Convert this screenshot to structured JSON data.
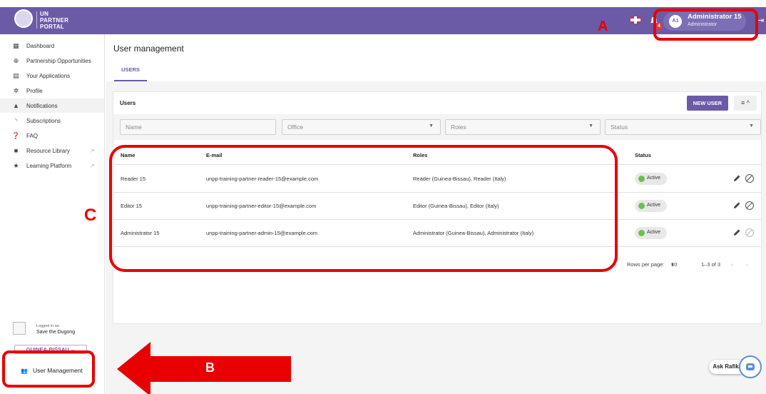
{
  "topbar": {
    "logo_line1": "UN",
    "logo_line2": "PARTNER",
    "logo_line3": "PORTAL",
    "notification_count": "4",
    "user_initials": "A1",
    "user_name": "Administrator 15",
    "user_role": "Administrator"
  },
  "sidebar": {
    "items": [
      {
        "label": "Dashboard",
        "icon": "dashboard-icon"
      },
      {
        "label": "Partnership Opportunities",
        "icon": "globe-icon"
      },
      {
        "label": "Your Applications",
        "icon": "clipboard-icon"
      },
      {
        "label": "Profile",
        "icon": "gear-icon"
      },
      {
        "label": "Notifications",
        "icon": "bell-icon"
      },
      {
        "label": "Subscriptions",
        "icon": "rss-icon"
      },
      {
        "label": "FAQ",
        "icon": "help-icon"
      },
      {
        "label": "Resource Library",
        "icon": "book-icon"
      },
      {
        "label": "Learning Platform",
        "icon": "star-icon"
      }
    ],
    "logged_in_label": "Logged in as:",
    "logged_in_org": "Save the Dugong",
    "country": "GUINEA-BISSAU",
    "user_management": "User Management"
  },
  "main": {
    "title": "User management",
    "tab": "USERS",
    "card_title": "Users",
    "new_user_button": "NEW USER",
    "filters": {
      "name_placeholder": "Name",
      "office_placeholder": "Office",
      "roles_placeholder": "Roles",
      "status_placeholder": "Status"
    },
    "columns": {
      "name": "Name",
      "email": "E-mail",
      "roles": "Roles",
      "status": "Status"
    },
    "rows": [
      {
        "name": "Reader 15",
        "email": "unpp-training-partner-reader-15@example.com",
        "roles": "Reader (Guinea-Bissau), Reader (Italy)",
        "status": "Active"
      },
      {
        "name": "Editor 15",
        "email": "unpp-training-partner-editor-15@example.com",
        "roles": "Editor (Guinea-Bissau), Editor (Italy)",
        "status": "Active"
      },
      {
        "name": "Administrator 15",
        "email": "unpp-training-partner-admin-15@example.com",
        "roles": "Administrator (Guinea-Bissau), Administrator (Italy)",
        "status": "Active"
      }
    ],
    "pager": {
      "rows_per_page_label": "Rows per page:",
      "rows_per_page_value": "10",
      "range": "1–3 of 3"
    }
  },
  "annotations": {
    "a": "A",
    "b": "B",
    "c": "C",
    "color": "#e80000"
  },
  "ask_rafiki": "Ask Rafiki!",
  "colors": {
    "brand": "#6b5ba7",
    "active": "#6cc04a"
  }
}
